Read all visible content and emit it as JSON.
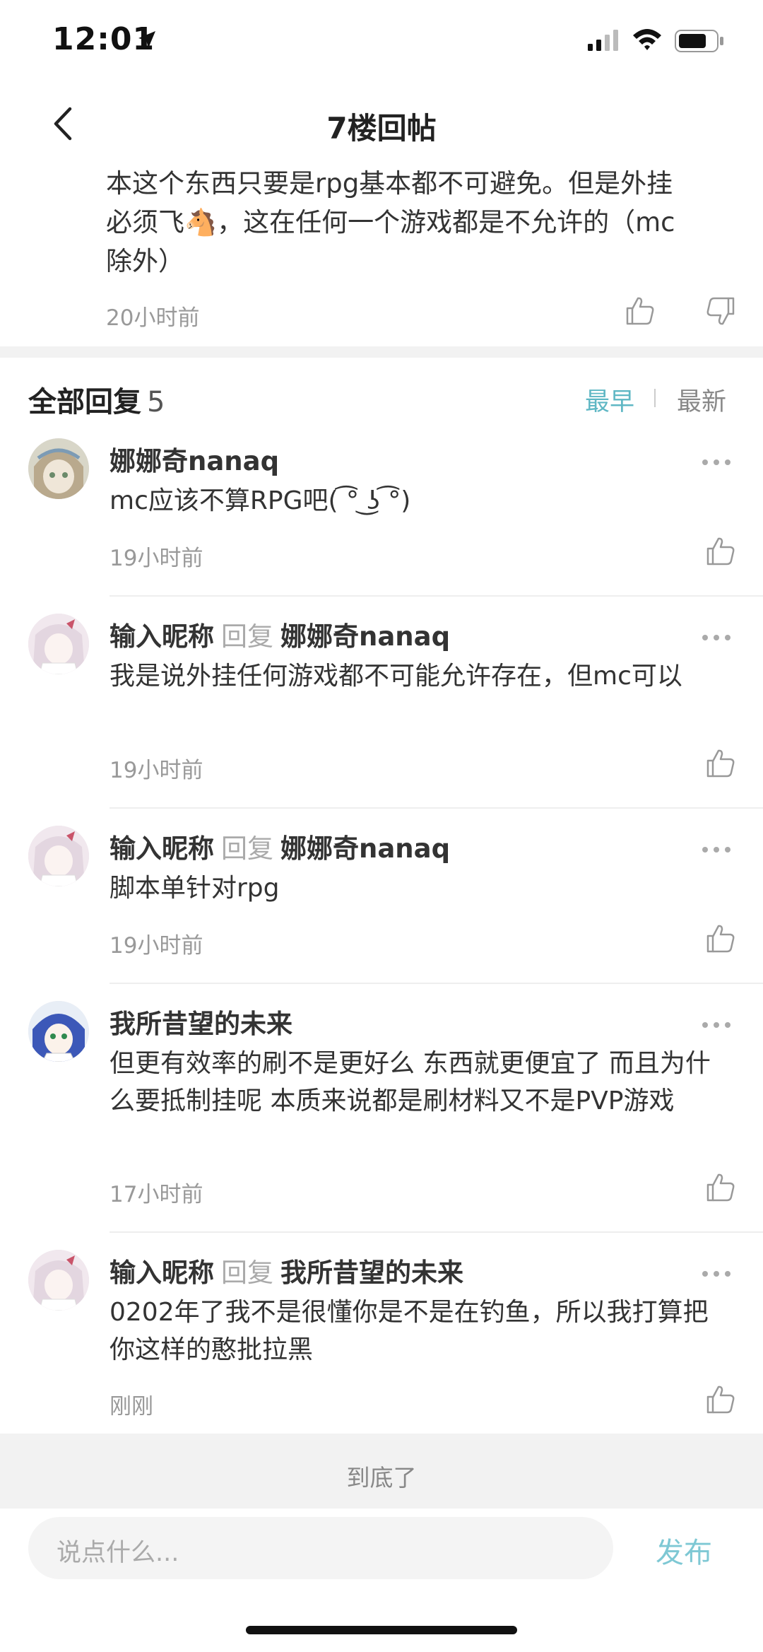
{
  "status_bar": {
    "time": "12:01"
  },
  "nav": {
    "title": "7楼回帖"
  },
  "post": {
    "body_line1": "本这个东西只要是rpg基本都不可避免。但是外挂",
    "body_line2a": "必须飞",
    "body_emoji": "🐴",
    "body_line2b": "，这在任何一个游戏都是不允许的（mc",
    "body_line3": "除外）",
    "time": "20小时前"
  },
  "replies_header": {
    "label": "全部回复",
    "count": "5",
    "sort_earliest": "最早",
    "sort_newest": "最新"
  },
  "replies": [
    {
      "author": "娜娜奇nanaq",
      "reply_word": "",
      "target": "",
      "text": "mc应该不算RPG吧( ͡° ͜ʖ ͡°)",
      "time": "19小时前"
    },
    {
      "author": "输入昵称",
      "reply_word": "回复",
      "target": "娜娜奇nanaq",
      "text": "我是说外挂任何游戏都不可能允许存在，但mc可以",
      "time": "19小时前"
    },
    {
      "author": "输入昵称",
      "reply_word": "回复",
      "target": "娜娜奇nanaq",
      "text": "脚本单针对rpg",
      "time": "19小时前"
    },
    {
      "author": "我所昔望的未来",
      "reply_word": "",
      "target": "",
      "text": "但更有效率的刷不是更好么 东西就更便宜了 而且为什么要抵制挂呢 本质来说都是刷材料又不是PVP游戏",
      "time": "17小时前"
    },
    {
      "author": "输入昵称",
      "reply_word": "回复",
      "target": "我所昔望的未来",
      "text": "0202年了我不是很懂你是不是在钓鱼，所以我打算把你这样的憨批拉黑",
      "time": "刚刚"
    }
  ],
  "footer": {
    "end_label": "到底了",
    "input_placeholder": "说点什么...",
    "publish_label": "发布"
  },
  "colors": {
    "accent": "#5fb7c4",
    "publish": "#7ec8d4",
    "muted": "#999999",
    "band": "#f2f2f2"
  }
}
